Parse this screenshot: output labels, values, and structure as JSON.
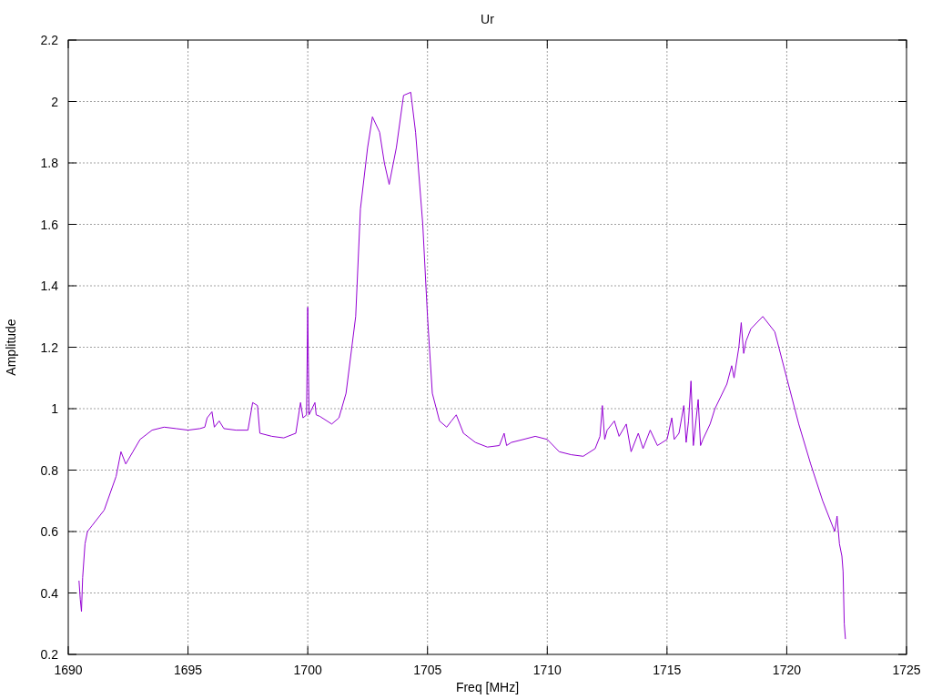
{
  "chart_data": {
    "type": "line",
    "grid": true,
    "title": "Ur",
    "xlabel": "Freq [MHz]",
    "ylabel": "Amplitude",
    "xlim": [
      1690,
      1725
    ],
    "ylim": [
      0.2,
      2.2
    ],
    "xticks": [
      1690,
      1695,
      1700,
      1705,
      1710,
      1715,
      1720,
      1725
    ],
    "yticks": [
      0.2,
      0.4,
      0.6,
      0.8,
      1,
      1.2,
      1.4,
      1.6,
      1.8,
      2,
      2.2
    ],
    "x": [
      1690.45,
      1690.5,
      1690.55,
      1690.6,
      1690.7,
      1690.8,
      1691,
      1691.5,
      1692,
      1692.2,
      1692.4,
      1692.7,
      1693,
      1693.5,
      1694,
      1694.5,
      1695,
      1695.5,
      1695.7,
      1695.8,
      1696,
      1696.1,
      1696.3,
      1696.5,
      1697,
      1697.5,
      1697.7,
      1697.9,
      1698,
      1698.5,
      1699,
      1699.5,
      1699.7,
      1699.8,
      1699.95,
      1700,
      1700.05,
      1700.3,
      1700.35,
      1700.5,
      1701,
      1701.3,
      1701.6,
      1702,
      1702.2,
      1702.5,
      1702.7,
      1703,
      1703.2,
      1703.4,
      1703.7,
      1704,
      1704.3,
      1704.5,
      1704.8,
      1705,
      1705.2,
      1705.5,
      1705.8,
      1706,
      1706.2,
      1706.5,
      1707,
      1707.5,
      1708,
      1708.2,
      1708.3,
      1708.5,
      1709,
      1709.5,
      1710,
      1710.5,
      1711,
      1711.5,
      1712,
      1712.2,
      1712.3,
      1712.4,
      1712.5,
      1712.8,
      1713,
      1713.3,
      1713.5,
      1713.8,
      1714,
      1714.3,
      1714.6,
      1715,
      1715.2,
      1715.3,
      1715.5,
      1715.7,
      1715.8,
      1715.9,
      1716,
      1716.1,
      1716.3,
      1716.4,
      1716.5,
      1716.8,
      1717,
      1717.5,
      1717.7,
      1717.8,
      1718,
      1718.1,
      1718.2,
      1718.3,
      1718.5,
      1719,
      1719.5,
      1720,
      1720.5,
      1721,
      1721.5,
      1722,
      1722.1,
      1722.2,
      1722.3,
      1722.35,
      1722.4,
      1722.45
    ],
    "series": [
      {
        "color": "#9400d3",
        "values": [
          0.44,
          0.38,
          0.34,
          0.45,
          0.56,
          0.6,
          0.62,
          0.67,
          0.78,
          0.86,
          0.82,
          0.86,
          0.9,
          0.93,
          0.94,
          0.935,
          0.93,
          0.935,
          0.94,
          0.97,
          0.99,
          0.94,
          0.96,
          0.935,
          0.93,
          0.93,
          1.02,
          1.01,
          0.92,
          0.91,
          0.905,
          0.92,
          1.02,
          0.97,
          0.98,
          1.33,
          0.98,
          1.02,
          0.98,
          0.975,
          0.95,
          0.97,
          1.05,
          1.3,
          1.65,
          1.85,
          1.95,
          1.9,
          1.8,
          1.73,
          1.85,
          2.02,
          2.03,
          1.9,
          1.6,
          1.3,
          1.05,
          0.96,
          0.94,
          0.96,
          0.98,
          0.92,
          0.89,
          0.875,
          0.88,
          0.92,
          0.88,
          0.89,
          0.9,
          0.91,
          0.9,
          0.86,
          0.85,
          0.845,
          0.87,
          0.91,
          1.01,
          0.9,
          0.93,
          0.96,
          0.91,
          0.95,
          0.86,
          0.92,
          0.87,
          0.93,
          0.88,
          0.9,
          0.97,
          0.9,
          0.92,
          1.01,
          0.89,
          0.96,
          1.09,
          0.88,
          1.03,
          0.88,
          0.9,
          0.95,
          1,
          1.08,
          1.14,
          1.1,
          1.2,
          1.28,
          1.18,
          1.22,
          1.26,
          1.3,
          1.25,
          1.1,
          0.95,
          0.82,
          0.7,
          0.6,
          0.65,
          0.56,
          0.52,
          0.47,
          0.3,
          0.25
        ]
      }
    ]
  }
}
